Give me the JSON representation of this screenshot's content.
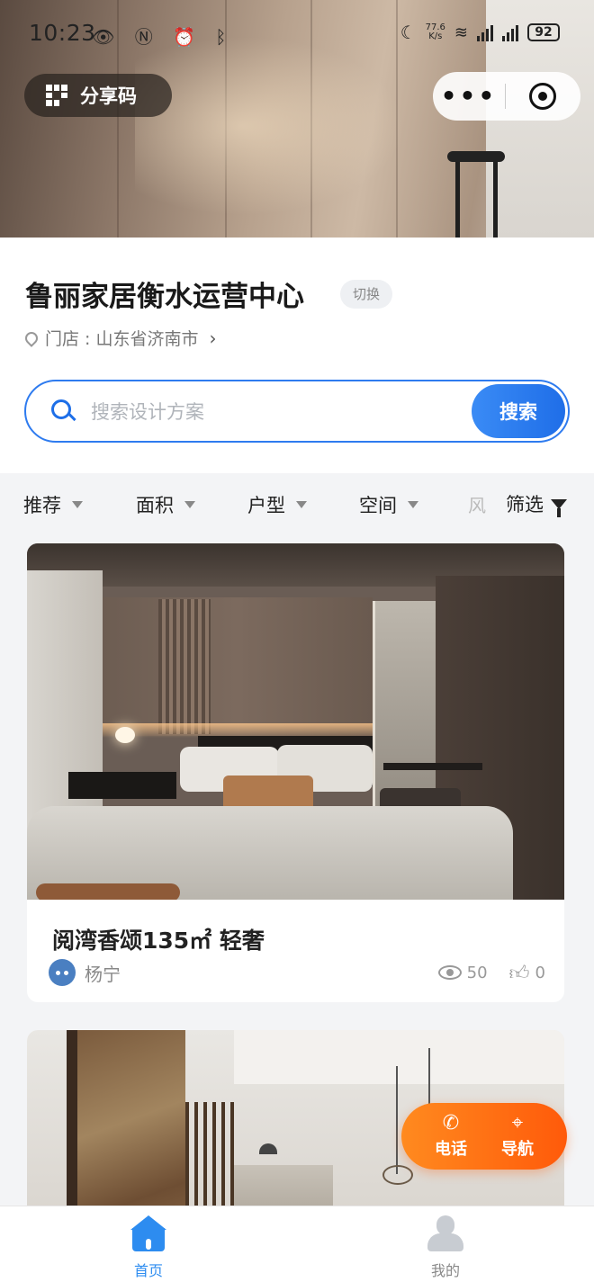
{
  "status_bar": {
    "time": "10:23",
    "net_speed_value": "77.6",
    "net_speed_unit": "K/s",
    "battery": "92"
  },
  "hero": {
    "share_code_label": "分享码"
  },
  "store": {
    "name": "鲁丽家居衡水运营中心",
    "switch_label": "切换",
    "address": "门店 : 山东省济南市"
  },
  "search": {
    "placeholder": "搜索设计方案",
    "button_label": "搜索"
  },
  "filters": {
    "items": [
      {
        "label": "推荐"
      },
      {
        "label": "面积"
      },
      {
        "label": "户型"
      },
      {
        "label": "空间"
      }
    ],
    "clipped_label": "风",
    "screen_label": "筛选"
  },
  "cards": [
    {
      "title": "阅湾香颂135㎡ 轻奢",
      "author": "杨宁",
      "views": "50",
      "likes": "0"
    }
  ],
  "fab": {
    "phone_label": "电话",
    "nav_label": "导航"
  },
  "tabbar": {
    "home_label": "首页",
    "me_label": "我的"
  },
  "colors": {
    "accent_blue": "#2d8cf0",
    "fab_orange": "#ff6a10"
  },
  "icons": [
    "qr-code-icon",
    "more-dots-icon",
    "close-circle-icon",
    "location-pin-icon",
    "search-icon",
    "filter-funnel-icon",
    "eye-icon",
    "thumb-up-icon",
    "phone-icon",
    "navigation-icon",
    "home-icon",
    "user-icon"
  ]
}
